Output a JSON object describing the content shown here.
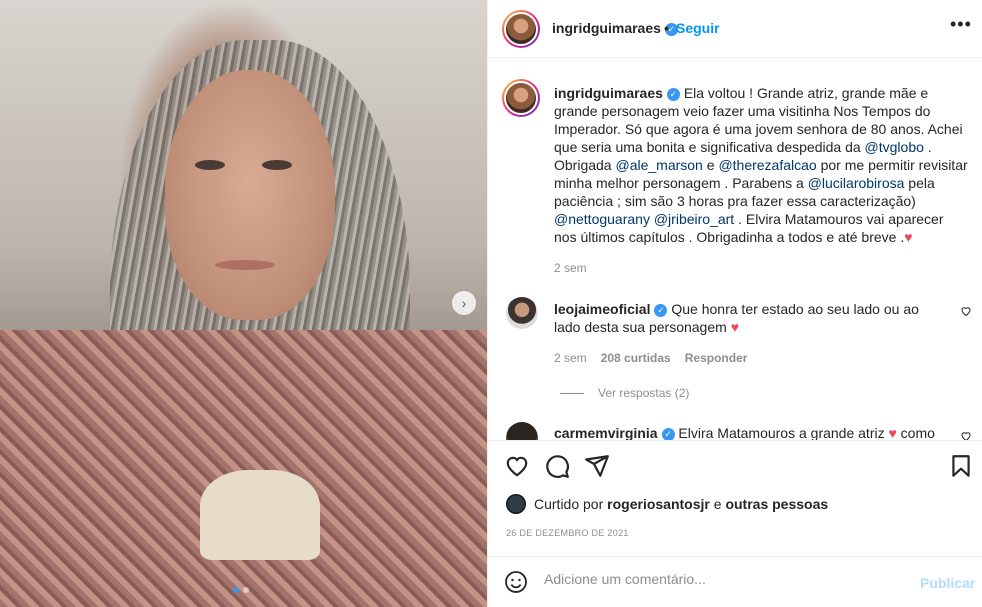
{
  "post": {
    "author": "ingridguimaraes",
    "follow_label": "Seguir",
    "bullet": "•",
    "more_label": "•••"
  },
  "photo": {
    "next_label": "›",
    "slide_count": 2,
    "active_slide": 1
  },
  "caption": {
    "user": "ingridguimaraes",
    "p1": "Ela voltou ! Grande atriz, grande mãe e grande personagem veio fazer uma visitinha Nos Tempos do Imperador. Só que agora é uma jovem senhora de 80 anos. Achei que seria uma bonita e significativa despedida da ",
    "m1": "@tvglobo",
    "p2": " . Obrigada ",
    "m2": "@ale_marson",
    "p3": " e ",
    "m3": "@therezafalcao",
    "p4": " por me permitir revisitar minha melhor personagem . Parabens a ",
    "m4": "@lucilarobirosa",
    "p5": " pela paciência ; sim são 3 horas pra fazer essa caracterização) ",
    "m5": "@nettoguarany",
    "p6": " ",
    "m6": "@jribeiro_art",
    "p7": " . Elvira Matamouros vai aparecer nos últimos capítulos . Obrigadinha a todos e até breve .",
    "heart": "♥",
    "time": "2 sem"
  },
  "comments": [
    {
      "user": "leojaimeoficial",
      "text": "Que honra ter estado ao seu lado ou ao lado desta sua personagem ",
      "heart": "♥",
      "time": "2 sem",
      "likes": "208 curtidas",
      "reply": "Responder",
      "view_replies": "Ver respostas (2)"
    },
    {
      "user": "carmemvirginia",
      "text": "Elvira Matamouros a grande atriz ",
      "heart": "♥",
      "tail": " como"
    }
  ],
  "likes": {
    "prefix": "Curtido por",
    "user": "rogeriosantosjr",
    "conj": "e",
    "others": "outras pessoas"
  },
  "date": "26 DE DEZEMBRO DE 2021",
  "add_comment": {
    "placeholder": "Adicione um comentário...",
    "publish": "Publicar"
  },
  "icons": {
    "like": "heart-outline",
    "comment": "speech-bubble",
    "share": "paper-plane",
    "save": "bookmark",
    "emoji": "smiley"
  },
  "colors": {
    "link": "#0095f6",
    "mention": "#00376b",
    "heart": "#ed4956",
    "muted": "#8e8e8e",
    "publish_disabled": "#b3dbff"
  }
}
